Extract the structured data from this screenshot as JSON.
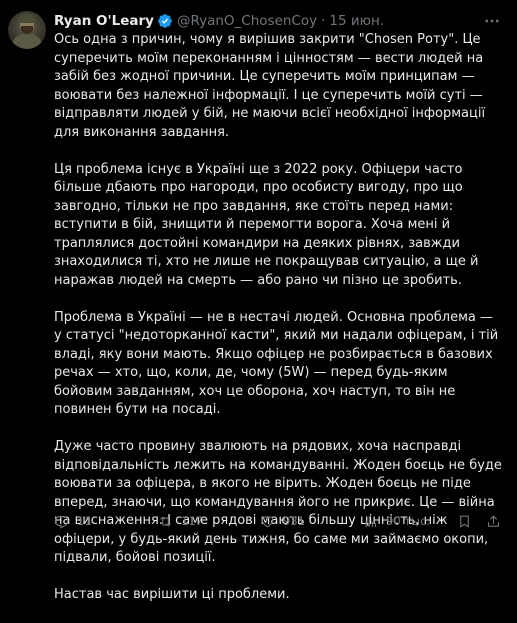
{
  "author": {
    "name": "Ryan O'Leary",
    "handle": "@RyanO_ChosenCoy",
    "separator": "·",
    "date": "15 июн."
  },
  "tweet": {
    "paragraphs": [
      "Ось одна з причин, чому я вирішив закрити \"Chosen Роту\". Це суперечить моїм переконанням і цінностям — вести людей на забій без жодної причини. Це суперечить моїм принципам — воювати без належної інформації. І це суперечить моїй суті — відправляти людей у бій, не маючи всієї необхідної інформації для виконання завдання.",
      "Ця проблема існує в Україні ще з 2022 року. Офіцери часто більше дбають про нагороди, про особисту вигоду, про що завгодно, тільки не про завдання, яке стоїть перед нами: вступити в бій, знищити й перемогти ворога. Хоча мені й траплялися достойні командири на деяких рівнях, завжди знаходилися ті, хто не лише не покращував ситуацію, а ще й наражав людей на смерть — або рано чи пізно це зробить.",
      "Проблема в Україні — не в нестачі людей. Основна проблема — у статусі \"недоторканної касти\", який ми надали офіцерам, і тій владі, яку вони мають. Якщо офіцер не розбирається в базових речах — хто, що, коли, де, чому (5W) — перед будь-яким бойовим завданням, хоч це оборона, хоч наступ, то він не повинен бути на посаді.",
      "Дуже часто провину звалюють на рядових, хоча насправді відповідальність лежить на командуванні. Жоден боєць не буде воювати за офіцера, в якого не вірить. Жоден боєць не піде вперед, знаючи, що командування його не прикриє. Це — війна на виснаження. І саме рядові мають більшу цінність, ніж офіцери, у будь-який день тижня, бо саме ми займаємо окопи, підвали, бойові позиції.",
      "Настав час вирішити ці проблеми."
    ]
  },
  "actions": {
    "replies": "11",
    "retweets": "117",
    "likes": "931",
    "views": "90 тыс."
  },
  "icons": {
    "avatar": "soldier-avatar",
    "verified": "verified-badge-icon",
    "more": "more-horizontal-icon",
    "reply": "reply-icon",
    "retweet": "retweet-icon",
    "like": "heart-icon",
    "views": "views-chart-icon",
    "bookmark": "bookmark-icon",
    "share": "share-icon"
  },
  "colors": {
    "background": "#000000",
    "text": "#e7e9ea",
    "muted": "#71767b",
    "verified": "#1d9bf0"
  }
}
